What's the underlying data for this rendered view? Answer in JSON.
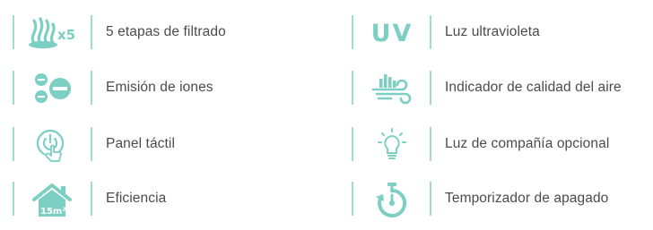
{
  "accent_color": "#7ccfc3",
  "features": [
    {
      "icon": "filter-stages-icon",
      "badge": "x5",
      "label": "5 etapas de filtrado"
    },
    {
      "icon": "uv-icon",
      "badge": "UV",
      "label": "Luz ultravioleta"
    },
    {
      "icon": "ions-icon",
      "label": "Emisión de iones"
    },
    {
      "icon": "air-quality-icon",
      "label": "Indicador de calidad del aire"
    },
    {
      "icon": "touch-panel-icon",
      "label": "Panel táctil"
    },
    {
      "icon": "light-bulb-icon",
      "label": "Luz de compañía opcional"
    },
    {
      "icon": "house-efficiency-icon",
      "badge": "15m²",
      "label": "Eficiencia"
    },
    {
      "icon": "timer-icon",
      "label": "Temporizador de apagado"
    }
  ]
}
